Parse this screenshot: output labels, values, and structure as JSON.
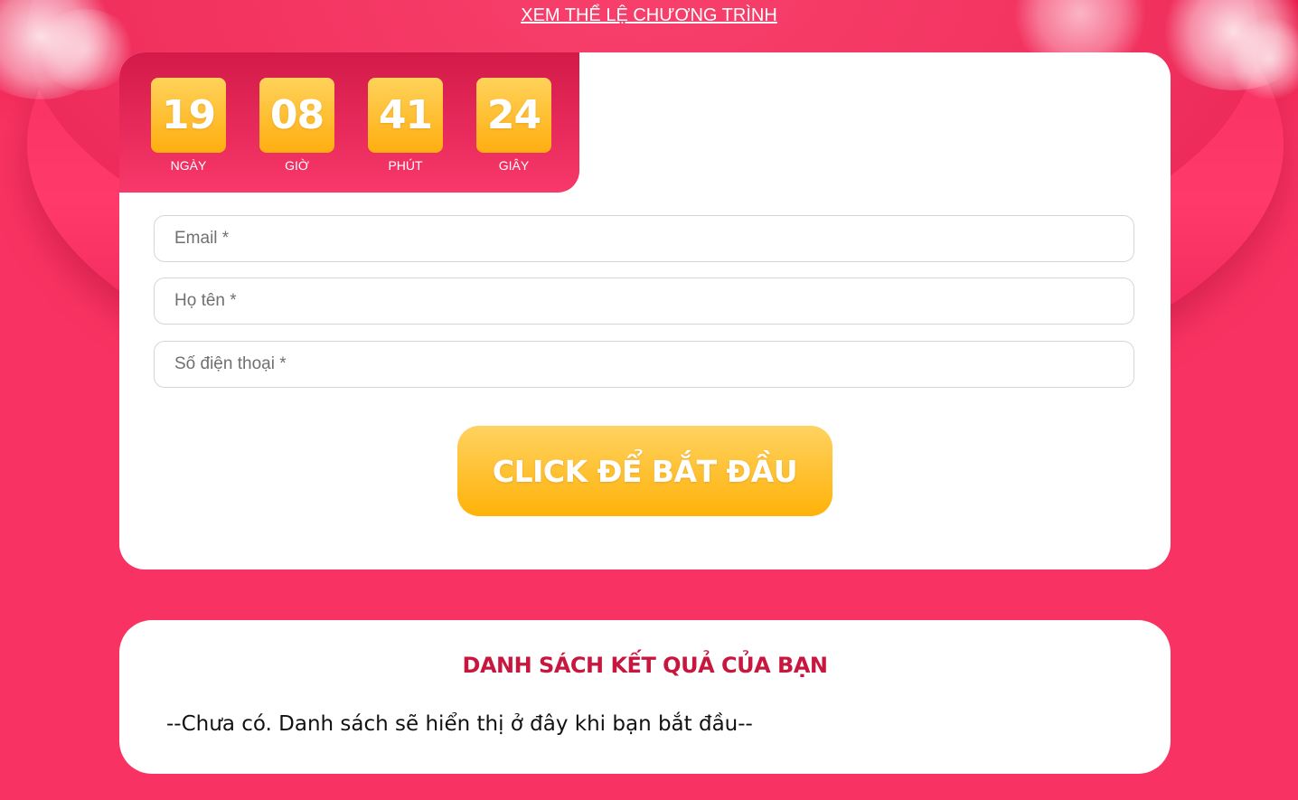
{
  "header": {
    "rules_link": "XEM THỂ LỆ CHƯƠNG TRÌNH"
  },
  "countdown": {
    "units": [
      {
        "value": "19",
        "label": "NGÀY"
      },
      {
        "value": "08",
        "label": "GIỜ"
      },
      {
        "value": "41",
        "label": "PHÚT"
      },
      {
        "value": "24",
        "label": "GIÂY"
      }
    ]
  },
  "form": {
    "email_placeholder": "Email *",
    "name_placeholder": "Họ tên *",
    "phone_placeholder": "Số điện thoại *",
    "start_button": "CLICK ĐỂ BẮT ĐẦU"
  },
  "results": {
    "title": "DANH SÁCH KẾT QUẢ CỦA BẠN",
    "empty_text": "--Chưa có. Danh sách sẽ hiển thị ở đây khi bạn bắt đầu--"
  },
  "colors": {
    "background": "#f83363",
    "accent_orange": "#ffb209",
    "title_red": "#c8173e"
  }
}
